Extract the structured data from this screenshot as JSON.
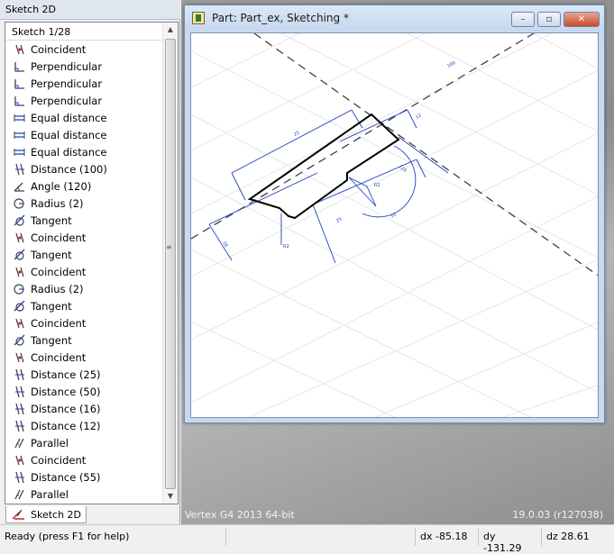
{
  "panel": {
    "title": "Sketch 2D",
    "header": "Sketch 1/28",
    "tab_label": "Sketch 2D",
    "items": [
      {
        "label": "Coincident",
        "icon": "coincident-icon"
      },
      {
        "label": "Perpendicular",
        "icon": "perpendicular-icon"
      },
      {
        "label": "Perpendicular",
        "icon": "perpendicular-icon"
      },
      {
        "label": "Perpendicular",
        "icon": "perpendicular-icon"
      },
      {
        "label": "Equal distance",
        "icon": "equal-distance-icon"
      },
      {
        "label": "Equal distance",
        "icon": "equal-distance-icon"
      },
      {
        "label": "Equal distance",
        "icon": "equal-distance-icon"
      },
      {
        "label": "Distance (100)",
        "icon": "distance-icon"
      },
      {
        "label": "Angle (120)",
        "icon": "angle-icon"
      },
      {
        "label": "Radius (2)",
        "icon": "radius-icon"
      },
      {
        "label": "Tangent",
        "icon": "tangent-icon"
      },
      {
        "label": "Coincident",
        "icon": "coincident-icon"
      },
      {
        "label": "Tangent",
        "icon": "tangent-icon"
      },
      {
        "label": "Coincident",
        "icon": "coincident-icon"
      },
      {
        "label": "Radius (2)",
        "icon": "radius-icon"
      },
      {
        "label": "Tangent",
        "icon": "tangent-icon"
      },
      {
        "label": "Coincident",
        "icon": "coincident-icon"
      },
      {
        "label": "Tangent",
        "icon": "tangent-icon"
      },
      {
        "label": "Coincident",
        "icon": "coincident-icon"
      },
      {
        "label": "Distance (25)",
        "icon": "distance-icon"
      },
      {
        "label": "Distance (50)",
        "icon": "distance-icon"
      },
      {
        "label": "Distance (16)",
        "icon": "distance-icon"
      },
      {
        "label": "Distance (12)",
        "icon": "distance-icon"
      },
      {
        "label": "Parallel",
        "icon": "parallel-icon"
      },
      {
        "label": "Coincident",
        "icon": "coincident-icon"
      },
      {
        "label": "Distance (55)",
        "icon": "distance-icon"
      },
      {
        "label": "Parallel",
        "icon": "parallel-icon"
      }
    ]
  },
  "window": {
    "title": "Part: Part_ex, Sketching *",
    "minimize": "–",
    "restore": "▫",
    "close": "✕"
  },
  "workspace": {
    "version_text": "Vertex G4  2013  64-bit",
    "build_text": "19.0.03 (r127038)"
  },
  "statusbar": {
    "message": "Ready (press F1 for help)",
    "dx": "dx -85.18",
    "dy": "dy -131.29",
    "dz": "dz 28.61"
  },
  "colors": {
    "dimension": "#1f3fbf",
    "geometry": "#000000",
    "grid": "#e4e4e4"
  }
}
